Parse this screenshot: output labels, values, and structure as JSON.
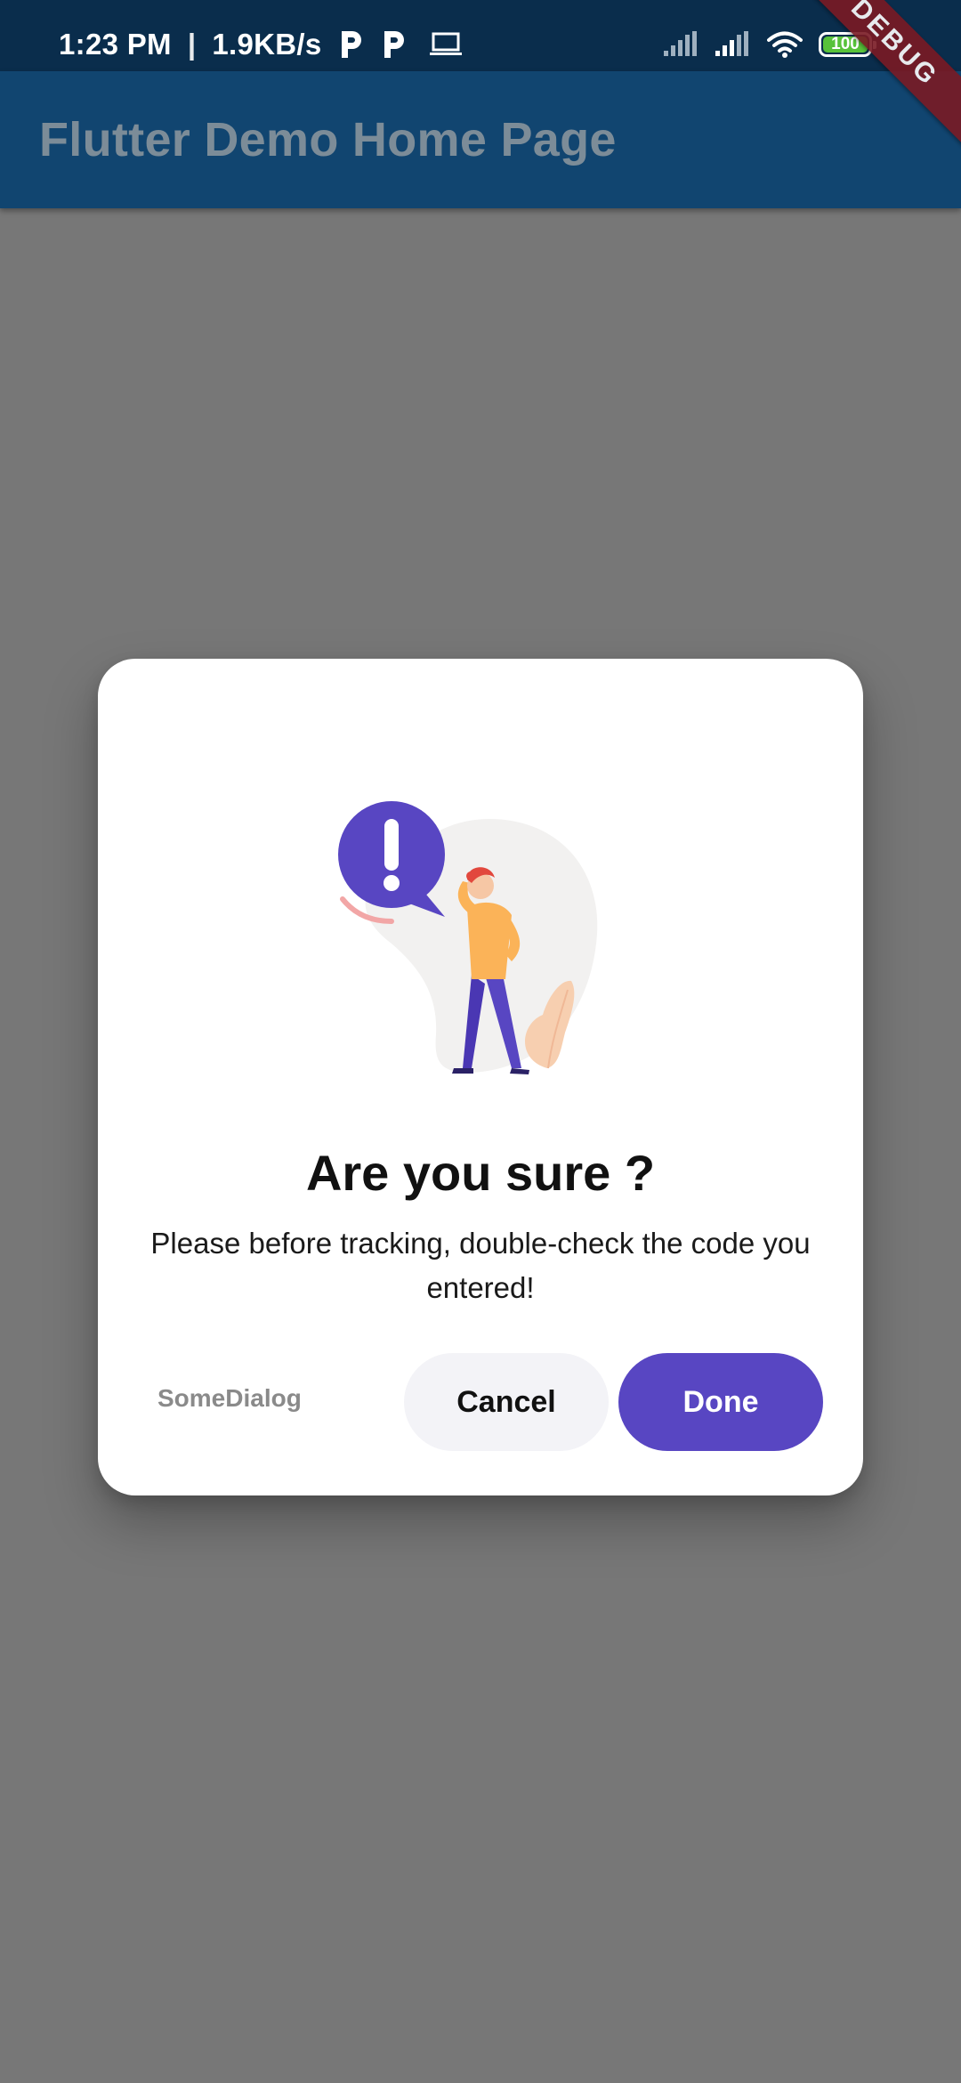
{
  "status_bar": {
    "time": "1:23 PM",
    "separator": "|",
    "network_speed": "1.9KB/s",
    "battery_level": "100",
    "icons": [
      "p-icon",
      "p-icon",
      "laptop-icon",
      "signal-icon",
      "signal-icon",
      "wifi-icon",
      "battery-icon"
    ]
  },
  "app_bar": {
    "title": "Flutter Demo Home Page",
    "debug_banner": "DEBUG"
  },
  "dialog": {
    "title": "Are you sure ?",
    "message": "Please before tracking, double-check the code you entered!",
    "tag": "SomeDialog",
    "cancel_label": "Cancel",
    "done_label": "Done"
  },
  "colors": {
    "status_bar": "#0a2d4c",
    "app_bar": "#114570",
    "scrim_background": "#777777",
    "dialog_background": "#ffffff",
    "primary_button": "#5846c2",
    "secondary_button": "#f3f3f7",
    "debug_banner": "#7a1a24"
  }
}
